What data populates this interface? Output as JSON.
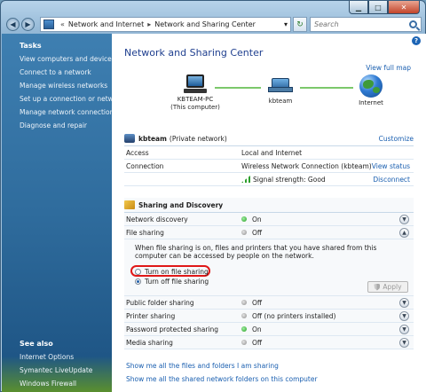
{
  "address": {
    "crumbs": [
      "Network and Internet",
      "Network and Sharing Center"
    ],
    "search_placeholder": "Search"
  },
  "tasks": {
    "heading": "Tasks",
    "items": [
      "View computers and devices",
      "Connect to a network",
      "Manage wireless networks",
      "Set up a connection or network",
      "Manage network connections",
      "Diagnose and repair"
    ]
  },
  "see_also": {
    "heading": "See also",
    "items": [
      "Internet Options",
      "Symantec LiveUpdate",
      "Windows Firewall"
    ]
  },
  "main": {
    "title": "Network and Sharing Center",
    "view_full_map": "View full map",
    "nodes": [
      {
        "name": "KBTEAM-PC",
        "sub": "(This computer)"
      },
      {
        "name": "kbteam"
      },
      {
        "name": "Internet"
      }
    ],
    "network": {
      "name": "kbteam",
      "type": "(Private network)",
      "customize": "Customize",
      "rows": [
        {
          "key": "Access",
          "value": "Local and Internet"
        },
        {
          "key": "Connection",
          "value": "Wireless Network Connection (kbteam)",
          "action": "View status"
        },
        {
          "key": "",
          "value": "Signal strength:  Good",
          "action": "Disconnect"
        }
      ]
    },
    "sharing": {
      "heading": "Sharing and Discovery",
      "network_discovery": {
        "label": "Network discovery",
        "status": "On"
      },
      "file_sharing": {
        "label": "File sharing",
        "status": "Off",
        "description": "When file sharing is on, files and printers that you have shared from this computer can be accessed by people on the network.",
        "option_on": "Turn on file sharing",
        "option_off": "Turn off file sharing",
        "apply": "Apply"
      },
      "public_folder": {
        "label": "Public folder sharing",
        "status": "Off"
      },
      "printer": {
        "label": "Printer sharing",
        "status": "Off (no printers installed)"
      },
      "password": {
        "label": "Password protected sharing",
        "status": "On"
      },
      "media": {
        "label": "Media sharing",
        "status": "Off"
      }
    },
    "links": [
      "Show me all the files and folders I am sharing",
      "Show me all the shared network folders on this computer"
    ]
  }
}
